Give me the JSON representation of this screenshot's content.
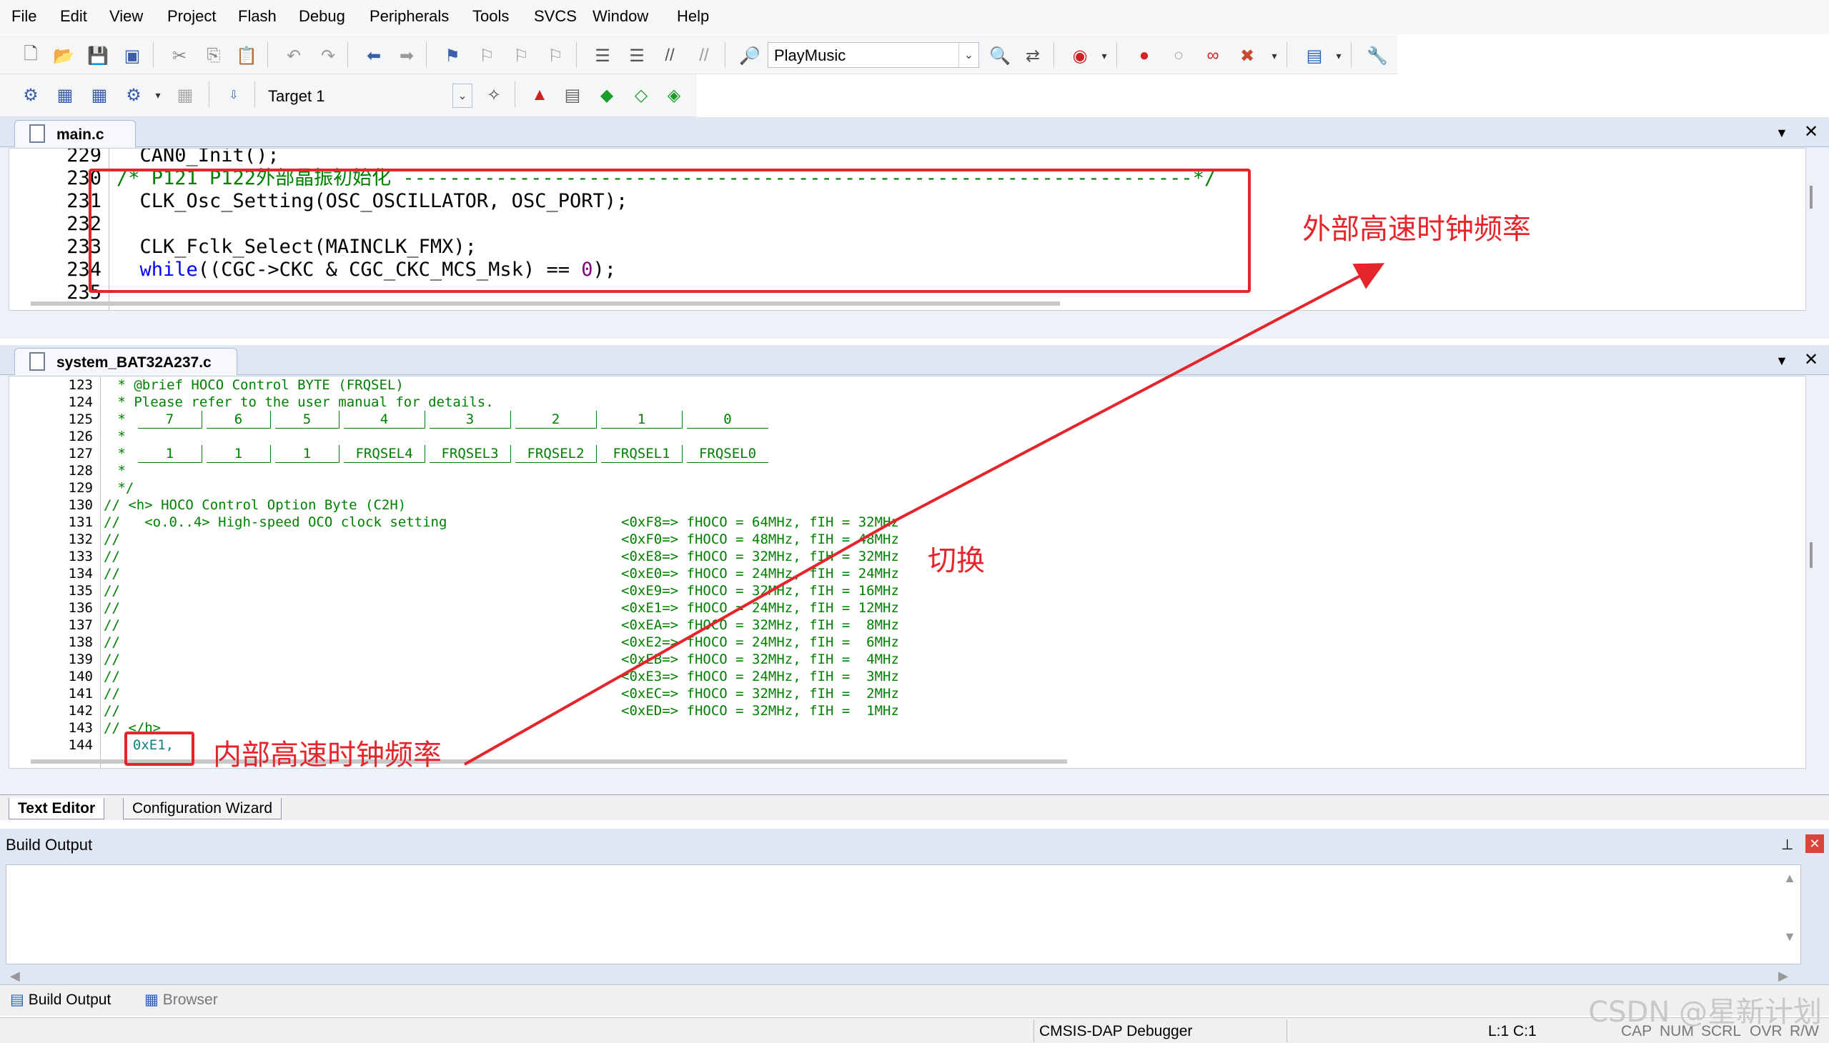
{
  "menu": [
    "File",
    "Edit",
    "View",
    "Project",
    "Flash",
    "Debug",
    "Peripherals",
    "Tools",
    "SVCS",
    "Window",
    "Help"
  ],
  "toolbar": {
    "target_combo": "PlayMusic",
    "target_select": "Target 1"
  },
  "tabs": {
    "main": "main.c",
    "system": "system_BAT32A237.c"
  },
  "main_code": {
    "line_numbers": [
      "229",
      "230",
      "231",
      "232",
      "233",
      "234",
      "235"
    ],
    "l229": "  CAN0_Init();",
    "l230": "/* P121 P122外部晶振初始化 --------------------------------------------------------------------*/",
    "l231": "  CLK_Osc_Setting(OSC_OSCILLATOR, OSC_PORT);",
    "l233": "  CLK_Fclk_Select(MAINCLK_FMX);",
    "l234_kw": "while",
    "l234_a": "((CGC->CKC & CGC_CKC_MCS_Msk) == ",
    "l234_num": "0",
    "l234_b": ");"
  },
  "system_code": {
    "line_numbers": [
      "123",
      "124",
      "125",
      "126",
      "127",
      "128",
      "129",
      "130",
      "131",
      "132",
      "133",
      "134",
      "135",
      "136",
      "137",
      "138",
      "139",
      "140",
      "141",
      "142",
      "143",
      "144"
    ],
    "l123": " * @brief HOCO Control BYTE (FRQSEL)",
    "l124": " * Please refer to the user manual for details.",
    "l125_prefix": " *",
    "bit_headers": [
      "7",
      "6",
      "5",
      "4",
      "3",
      "2",
      "1",
      "0"
    ],
    "l126": " *",
    "l127_prefix": " *",
    "bit_values": [
      "1",
      "1",
      "1",
      "FRQSEL4",
      "FRQSEL3",
      "FRQSEL2",
      "FRQSEL1",
      "FRQSEL0"
    ],
    "l128": " *",
    "l129": " */",
    "l130": "// <h> HOCO Control Option Byte (C2H)",
    "l131_left": "//   <o.0..4> High-speed OCO clock setting",
    "comment_slashes": "//",
    "hoco_options": [
      "<0xF8=> fHOCO = 64MHz, fIH = 32MHz",
      "<0xF0=> fHOCO = 48MHz, fIH = 48MHz",
      "<0xE8=> fHOCO = 32MHz, fIH = 32MHz",
      "<0xE0=> fHOCO = 24MHz, fIH = 24MHz",
      "<0xE9=> fHOCO = 32MHz, fIH = 16MHz",
      "<0xE1=> fHOCO = 24MHz, fIH = 12MHz",
      "<0xEA=> fHOCO = 32MHz, fIH =  8MHz",
      "<0xE2=> fHOCO = 24MHz, fIH =  6MHz",
      "<0xEB=> fHOCO = 32MHz, fIH =  4MHz",
      "<0xE3=> fHOCO = 24MHz, fIH =  3MHz",
      "<0xEC=> fHOCO = 32MHz, fIH =  2MHz",
      "<0xED=> fHOCO = 32MHz, fIH =  1MHz"
    ],
    "l143": "// </h>",
    "l144": "  0xE1,"
  },
  "editor_tabs": [
    "Text Editor",
    "Configuration Wizard"
  ],
  "build_output": {
    "title": "Build Output",
    "tabs": [
      "Build Output",
      "Browser"
    ]
  },
  "status": {
    "debugger": "CMSIS-DAP Debugger",
    "position": "L:1 C:1",
    "caps": "CAP",
    "num": "NUM",
    "scrl": "SCRL",
    "ovr": "OVR",
    "rw": "R/W"
  },
  "annotations": {
    "external_clock": "外部高速时钟频率",
    "switch": "切换",
    "internal_clock": "内部高速时钟频率"
  },
  "watermark": "CSDN @星新计划",
  "colors": {
    "annotation_red": "#e5242b",
    "comment_green": "#008000",
    "keyword_blue": "#0000ff"
  }
}
